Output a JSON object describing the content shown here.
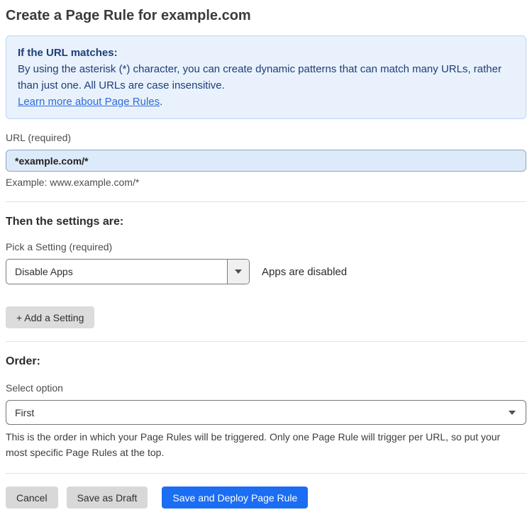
{
  "page": {
    "title": "Create a Page Rule for example.com"
  },
  "info_box": {
    "heading": "If the URL matches:",
    "body": "By using the asterisk (*) character, you can create dynamic patterns that can match many URLs, rather than just one. All URLs are case insensitive.",
    "link_text": "Learn more about Page Rules",
    "link_suffix": "."
  },
  "url_field": {
    "label": "URL (required)",
    "value": "*example.com/*",
    "example": "Example: www.example.com/*"
  },
  "settings": {
    "heading": "Then the settings are:",
    "picker_label": "Pick a Setting (required)",
    "selected_setting": "Disable Apps",
    "setting_description": "Apps are disabled",
    "add_setting_label": "+ Add a Setting"
  },
  "order": {
    "heading": "Order:",
    "select_label": "Select option",
    "selected_option": "First",
    "help_text": "This is the order in which your Page Rules will be triggered. Only one Page Rule will trigger per URL, so put your most specific Page Rules at the top."
  },
  "actions": {
    "cancel_label": "Cancel",
    "save_draft_label": "Save as Draft",
    "save_deploy_label": "Save and Deploy Page Rule"
  },
  "colors": {
    "info_box_background": "#e9f1fc",
    "info_box_border": "#bdd7f5",
    "info_box_text": "#1e3e78",
    "link_blue": "#2e6cd9",
    "url_input_background": "#ddeafa",
    "primary_button_blue": "#1b6ef3",
    "secondary_button_gray": "#d8d8d8"
  }
}
